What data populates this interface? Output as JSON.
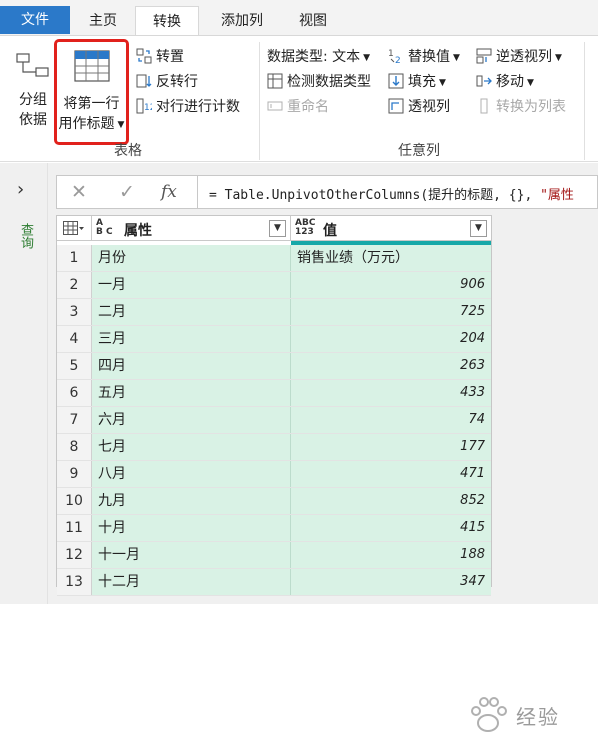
{
  "tabs": {
    "file": "文件",
    "home": "主页",
    "transform": "转换",
    "add_column": "添加列",
    "view": "视图"
  },
  "ribbon": {
    "group_by_line1": "分组",
    "group_by_line2": "依据",
    "use_first_row_line1": "将第一行",
    "use_first_row_line2": "用作标题",
    "transpose": "转置",
    "reverse_rows": "反转行",
    "count_rows": "对行进行计数",
    "table_group_label": "表格",
    "data_type": "数据类型: 文本",
    "detect_data_type": "检测数据类型",
    "rename": "重命名",
    "replace_values": "替换值",
    "fill": "填充",
    "pivot_column": "透视列",
    "unpivot_columns": "逆透视列",
    "move": "移动",
    "convert_to_list": "转换为列表",
    "any_column_group_label": "任意列"
  },
  "queries_pane": {
    "label": "查询"
  },
  "formula_bar": {
    "cancel_symbol": "✕",
    "confirm_symbol": "✓",
    "fx_symbol": "fx",
    "formula_prefix": "= Table.UnpivotOtherColumns(提升的标题, {}, ",
    "formula_string": "\"属性"
  },
  "grid": {
    "columns": [
      {
        "name": "属性",
        "type_icon_top": "A",
        "type_icon_bottom": "B C"
      },
      {
        "name": "值",
        "type_icon_top": "ABC",
        "type_icon_bottom": "123"
      }
    ],
    "rows": [
      {
        "n": "1",
        "attr": "月份",
        "value": "销售业绩（万元）"
      },
      {
        "n": "2",
        "attr": "一月",
        "value": "906"
      },
      {
        "n": "3",
        "attr": "二月",
        "value": "725"
      },
      {
        "n": "4",
        "attr": "三月",
        "value": "204"
      },
      {
        "n": "5",
        "attr": "四月",
        "value": "263"
      },
      {
        "n": "6",
        "attr": "五月",
        "value": "433"
      },
      {
        "n": "7",
        "attr": "六月",
        "value": "74"
      },
      {
        "n": "8",
        "attr": "七月",
        "value": "177"
      },
      {
        "n": "9",
        "attr": "八月",
        "value": "471"
      },
      {
        "n": "10",
        "attr": "九月",
        "value": "852"
      },
      {
        "n": "11",
        "attr": "十月",
        "value": "415"
      },
      {
        "n": "12",
        "attr": "十一月",
        "value": "188"
      },
      {
        "n": "13",
        "attr": "十二月",
        "value": "347"
      }
    ]
  },
  "watermark": {
    "text": "经验"
  },
  "colors": {
    "file_tab": "#2b79c9",
    "highlight_box": "#e1211c",
    "cell_fill": "#d9f2e5",
    "column_accent": "#16a8a8"
  }
}
